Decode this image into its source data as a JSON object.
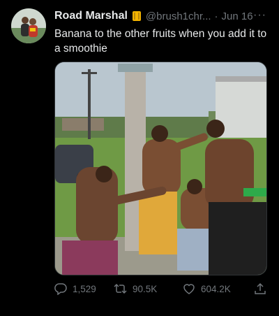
{
  "tweet": {
    "display_name": "Road Marshal",
    "handle": "@brush1chr...",
    "separator": "·",
    "date": "Jun 16",
    "more_label": "···",
    "text": "Banana to the other fruits when you add it to a smoothie",
    "stats": {
      "replies": "1,529",
      "retweets": "90.5K",
      "likes": "604.2K"
    }
  },
  "icons": {
    "verified_emoji": "construction-worker-emoji-icon",
    "reply": "reply-icon",
    "retweet": "retweet-icon",
    "like": "heart-icon",
    "share": "share-icon",
    "more": "more-options-icon"
  },
  "colors": {
    "background": "#000000",
    "primary_text": "#e7e9ea",
    "secondary_text": "#71767b",
    "border": "#2f3336"
  }
}
